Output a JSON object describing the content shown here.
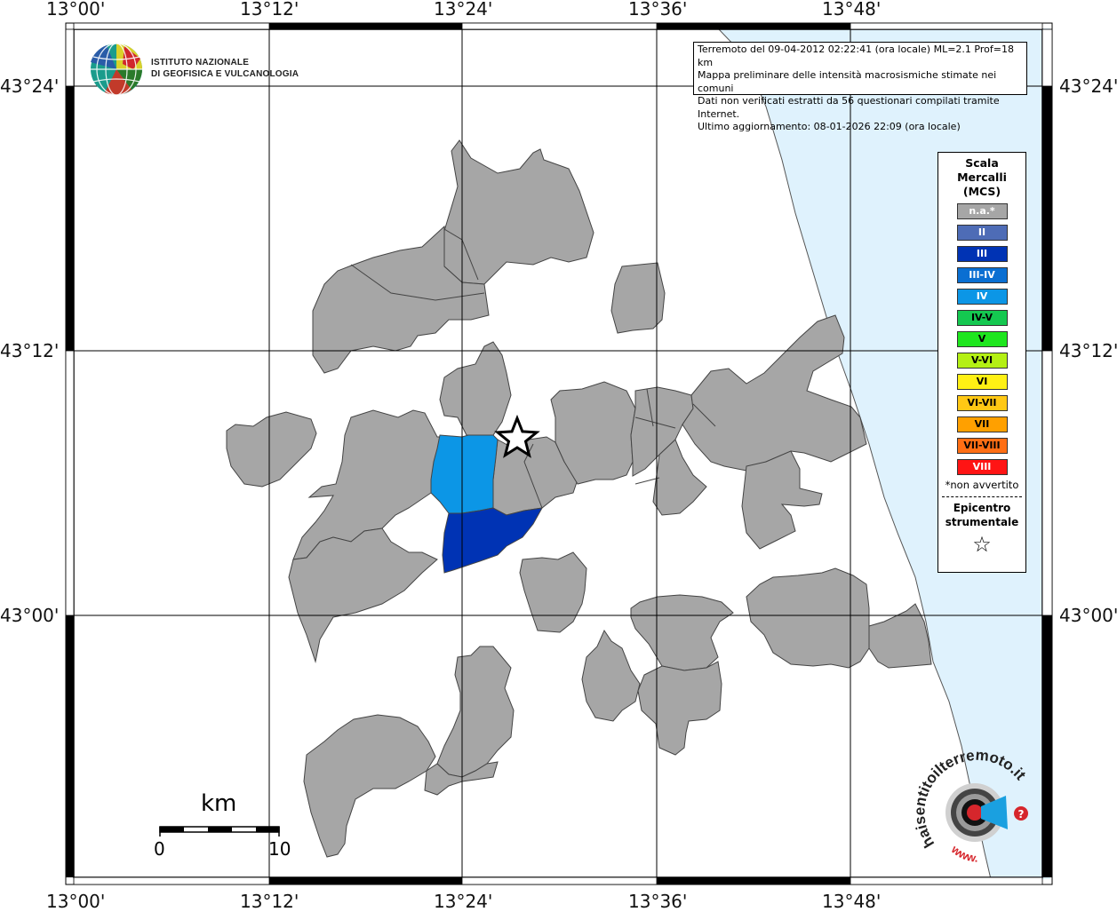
{
  "map": {
    "lon_ticks": [
      "13°00'",
      "13°12'",
      "13°24'",
      "13°36'",
      "13°48'"
    ],
    "lat_ticks": [
      "43°24'",
      "43°12'",
      "43°00'"
    ],
    "colors": {
      "sea": "#dff2fd",
      "na_fill": "#a6a6a6",
      "iv_fill": "#0c96e6",
      "iii_fill": "#0033b4",
      "border": "#444444"
    },
    "epicenter_symbol": "star"
  },
  "info_box": {
    "line1": "Terremoto del 09-04-2012 02:22:41 (ora locale) ML=2.1 Prof=18 km",
    "line2": "Mappa preliminare delle intensità macrosismiche stimate nei comuni",
    "line3": "Dati non verificati estratti da 56 questionari compilati tramite Internet.",
    "line4": "Ultimo aggiornamento: 08-01-2026 22:09 (ora locale)"
  },
  "logo_ingv": {
    "line1": "ISTITUTO NAZIONALE",
    "line2": "DI GEOFISICA E VULCANOLOGIA"
  },
  "legend": {
    "title": [
      "Scala",
      "Mercalli",
      "(MCS)"
    ],
    "items": [
      {
        "label": "n.a.*",
        "color": "#a6a6a6",
        "text": "#ffffff"
      },
      {
        "label": "II",
        "color": "#4e6cb6",
        "text": "#ffffff"
      },
      {
        "label": "III",
        "color": "#0033b4",
        "text": "#ffffff"
      },
      {
        "label": "III-IV",
        "color": "#0a6fd2",
        "text": "#ffffff"
      },
      {
        "label": "IV",
        "color": "#0c96e6",
        "text": "#ffffff"
      },
      {
        "label": "IV-V",
        "color": "#14c850",
        "text": "#000000"
      },
      {
        "label": "V",
        "color": "#1ee61e",
        "text": "#000000"
      },
      {
        "label": "V-VI",
        "color": "#b4f014",
        "text": "#000000"
      },
      {
        "label": "VI",
        "color": "#fff014",
        "text": "#000000"
      },
      {
        "label": "VI-VII",
        "color": "#ffc814",
        "text": "#000000"
      },
      {
        "label": "VII",
        "color": "#ffa000",
        "text": "#000000"
      },
      {
        "label": "VII-VIII",
        "color": "#ff6e14",
        "text": "#000000"
      },
      {
        "label": "VIII",
        "color": "#ff1414",
        "text": "#ffffff"
      }
    ],
    "note": "*non avvertito",
    "epicenter": [
      "Epicentro",
      "strumentale"
    ],
    "epicenter_star": "☆"
  },
  "scale_bar": {
    "unit": "km",
    "start": "0",
    "end": "10"
  },
  "logo_haisentito": {
    "text": "haisentitoilterremoto.it",
    "url": "www."
  }
}
